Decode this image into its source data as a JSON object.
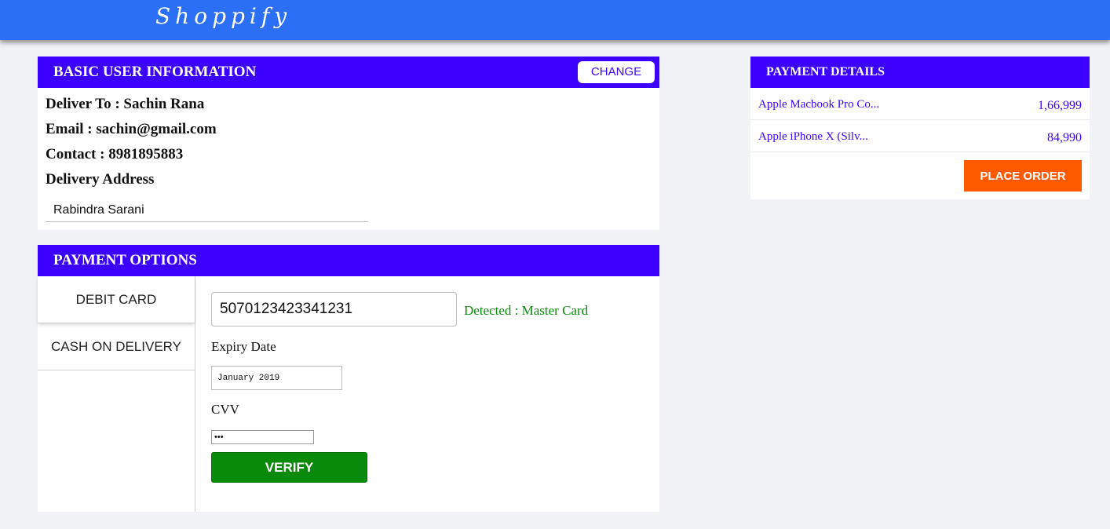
{
  "header": {
    "brand": "Shoppify"
  },
  "user_info": {
    "title": "BASIC USER INFORMATION",
    "change_label": "CHANGE",
    "deliver_to": "Deliver To : Sachin Rana",
    "email": "Email : sachin@gmail.com",
    "contact": "Contact : 8981895883",
    "address_label": "Delivery Address",
    "address_value": "Rabindra Sarani"
  },
  "payment_options": {
    "title": "PAYMENT OPTIONS",
    "tabs": [
      {
        "label": "DEBIT CARD",
        "active": true
      },
      {
        "label": "CASH ON DELIVERY",
        "active": false
      }
    ],
    "card_number": "5070123423341231",
    "detected": "Detected : Master Card",
    "expiry_label": "Expiry Date",
    "expiry_value": "January 2019",
    "cvv_label": "CVV",
    "cvv_value": "123",
    "verify_label": "VERIFY"
  },
  "payment_details": {
    "title": "PAYMENT DETAILS",
    "items": [
      {
        "name": "Apple Macbook Pro Co...",
        "price": "1,66,999"
      },
      {
        "name": "Apple iPhone X (Silv...",
        "price": "84,990"
      }
    ],
    "place_order_label": "PLACE ORDER"
  },
  "colors": {
    "topbar": "#2b6ff6",
    "panel_header": "#3c00ff",
    "verify": "#0a8a0a",
    "place_order": "#ff5a00",
    "detected_text": "#0a8a0a"
  }
}
